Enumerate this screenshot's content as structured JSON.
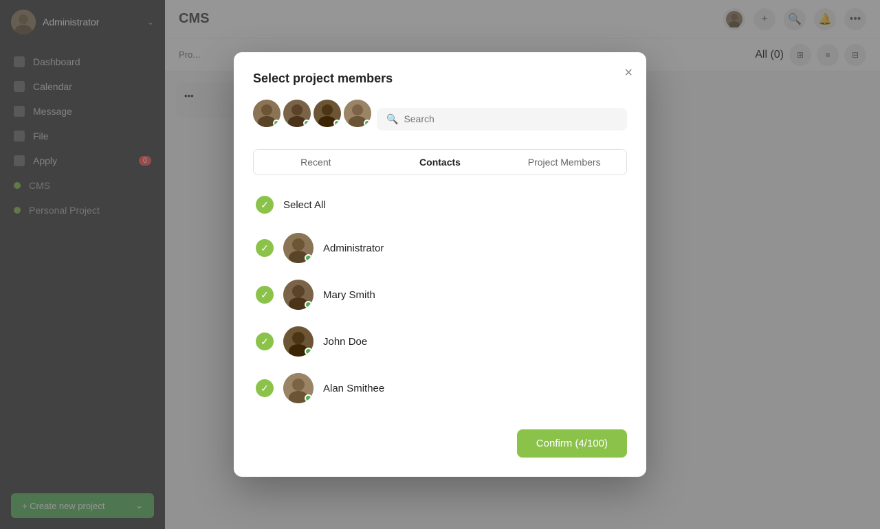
{
  "sidebar": {
    "username": "Administrator",
    "nav_items": [
      {
        "id": "dashboard",
        "label": "Dashboard"
      },
      {
        "id": "calendar",
        "label": "Calendar"
      },
      {
        "id": "message",
        "label": "Message"
      },
      {
        "id": "file",
        "label": "File"
      },
      {
        "id": "apply",
        "label": "Apply",
        "badge": "0"
      }
    ],
    "projects": [
      {
        "id": "cms",
        "label": "CMS"
      },
      {
        "id": "personal",
        "label": "Personal Project"
      }
    ],
    "create_btn": "+ Create new project"
  },
  "main": {
    "title": "CMS",
    "kanban_filter": "All (0)"
  },
  "modal": {
    "title": "Select project members",
    "close_label": "×",
    "search_placeholder": "Search",
    "tabs": [
      {
        "id": "recent",
        "label": "Recent"
      },
      {
        "id": "contacts",
        "label": "Contacts",
        "active": true
      },
      {
        "id": "project_members",
        "label": "Project Members"
      }
    ],
    "select_all_label": "Select All",
    "contacts": [
      {
        "id": "admin",
        "name": "Administrator",
        "online": true,
        "selected": true
      },
      {
        "id": "mary",
        "name": "Mary Smith",
        "online": true,
        "selected": true
      },
      {
        "id": "john",
        "name": "John Doe",
        "online": true,
        "selected": true
      },
      {
        "id": "alan",
        "name": "Alan Smithee",
        "online": true,
        "selected": true
      }
    ],
    "confirm_label": "Confirm (4/100)"
  }
}
